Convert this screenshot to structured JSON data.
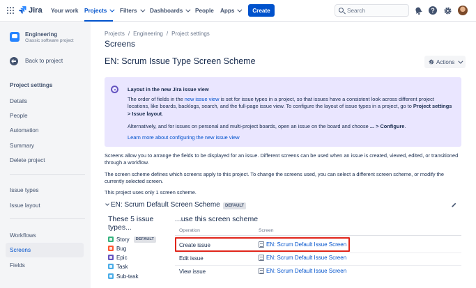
{
  "topnav": {
    "brand": "Jira",
    "items": [
      {
        "label": "Your work",
        "dropdown": false,
        "active": false
      },
      {
        "label": "Projects",
        "dropdown": true,
        "active": true
      },
      {
        "label": "Filters",
        "dropdown": true,
        "active": false
      },
      {
        "label": "Dashboards",
        "dropdown": true,
        "active": false
      },
      {
        "label": "People",
        "dropdown": false,
        "active": false
      },
      {
        "label": "Apps",
        "dropdown": true,
        "active": false
      }
    ],
    "create_label": "Create",
    "search_placeholder": "Search",
    "help_glyph": "?"
  },
  "sidebar": {
    "project_name": "Engineering",
    "project_type": "Classic software project",
    "back_label": "Back to project",
    "section_heading": "Project settings",
    "items": [
      "Details",
      "People",
      "Automation",
      "Summary",
      "Delete project",
      "Issue types",
      "Issue layout",
      "Workflows",
      "Screens",
      "Fields"
    ],
    "active_item": "Screens"
  },
  "main": {
    "breadcrumb": [
      "Projects",
      "Engineering",
      "Project settings"
    ],
    "breadcrumb_sep": "/",
    "page_title": "Screens",
    "scheme_title": "EN: Scrum Issue Type Screen Scheme",
    "actions_label": "Actions",
    "info": {
      "title": "Layout in the new Jira issue view",
      "p1_a": "The order of fields in the ",
      "p1_link": "new issue view",
      "p1_b": " is set for issue types in a project, so that issues have a consistent look across different project locations, like boards, backlogs, search, and the full-page issue view. To configure the layout of issue types in a project, go to ",
      "p1_bold": "Project settings > Issue layout",
      "p1_c": ".",
      "p2_a": "Alternatively, and for issues on personal and multi-project boards, open an issue on the board and choose ",
      "p2_bold": "... > Configure",
      "p2_c": ".",
      "learn_more": "Learn more about configuring the new issue view"
    },
    "para1": "Screens allow you to arrange the fields to be displayed for an issue. Different screens can be used when an issue is created, viewed, edited, or transitioned through a workflow.",
    "para2": "The screen scheme defines which screens apply to this project. To change the screens used, you can select a different screen scheme, or modify the currently selected screen.",
    "para3": "This project uses only 1 screen scheme.",
    "screen_scheme": {
      "name": "EN: Scrum Default Screen Scheme",
      "badge": "DEFAULT",
      "types_heading": "These 5 issue types...",
      "issue_types": [
        {
          "name": "Story",
          "icon": "story-icon",
          "badge": "DEFAULT"
        },
        {
          "name": "Bug",
          "icon": "bug-icon",
          "badge": ""
        },
        {
          "name": "Epic",
          "icon": "epic-icon",
          "badge": ""
        },
        {
          "name": "Task",
          "icon": "task-icon",
          "badge": ""
        },
        {
          "name": "Sub-task",
          "icon": "subtask-icon",
          "badge": ""
        }
      ],
      "use_heading": "...use this screen scheme",
      "col_operation": "Operation",
      "col_screen": "Screen",
      "rows": [
        {
          "operation": "Create issue",
          "screen": "EN: Scrum Default Issue Screen"
        },
        {
          "operation": "Edit issue",
          "screen": "EN: Scrum Default Issue Screen"
        },
        {
          "operation": "View issue",
          "screen": "EN: Scrum Default Issue Screen"
        }
      ]
    }
  },
  "colors": {
    "accent": "#0052cc",
    "info_bg": "#eae6ff",
    "highlight": "#e0251a"
  }
}
